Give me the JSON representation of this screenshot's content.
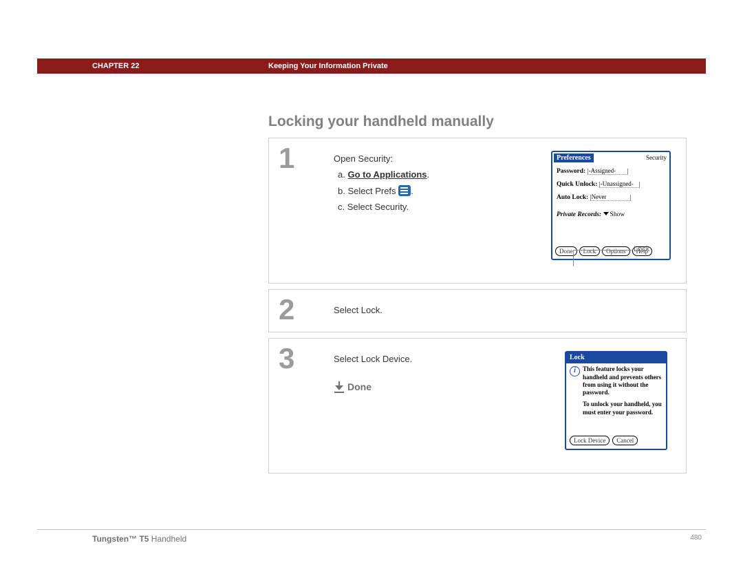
{
  "chapter": {
    "label": "CHAPTER 22",
    "title": "Keeping Your Information Private"
  },
  "heading": "Locking your handheld manually",
  "step1": {
    "num": "1",
    "intro": "Open Security:",
    "a_prefix": "a. ",
    "a_link": "Go to Applications",
    "a_suffix": ".",
    "b_prefix": "b.  Select Prefs ",
    "b_suffix": ".",
    "c": "c.  Select Security."
  },
  "step2": {
    "num": "2",
    "text": "Select Lock."
  },
  "step3": {
    "num": "3",
    "text": "Select Lock Device.",
    "done": "Done"
  },
  "palm_prefs": {
    "title": "Preferences",
    "category": "Security",
    "password_label": "Password:",
    "password_value": "-Assigned-",
    "quick_label": "Quick Unlock:",
    "quick_value": "-Unassigned-",
    "auto_label": "Auto Lock:",
    "auto_value": "Never",
    "private_label": "Private Records:",
    "private_value": "Show",
    "btn_done": "Done",
    "btn_lock": "Lock",
    "btn_options": "Options",
    "btn_help": "Help"
  },
  "lock_callout": "Lock",
  "palm_lock": {
    "title": "Lock",
    "para1": "This feature locks your handheld and prevents others from using it without the password.",
    "para2": "To unlock your handheld, you must enter your password.",
    "btn_lock_device": "Lock Device",
    "btn_cancel": "Cancel"
  },
  "footer": {
    "product_bold": "Tungsten™ T5",
    "product_rest": " Handheld",
    "page": "480"
  }
}
